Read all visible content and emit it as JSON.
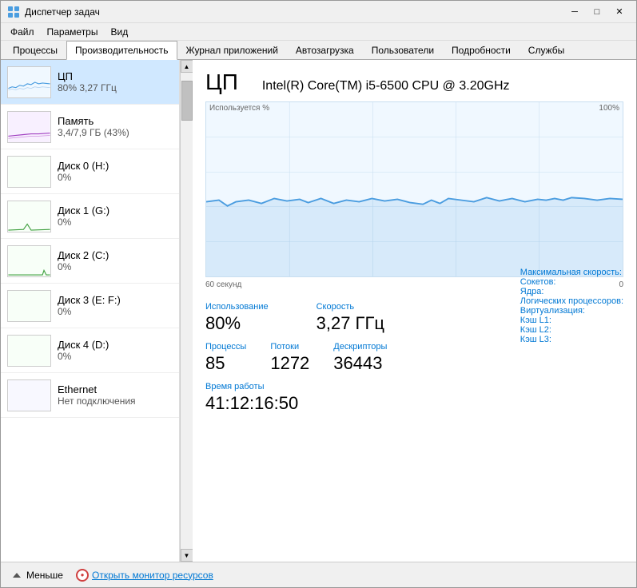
{
  "window": {
    "title": "Диспетчер задач",
    "icon": "⊞"
  },
  "title_buttons": {
    "minimize": "─",
    "maximize": "□",
    "close": "✕"
  },
  "menu": {
    "items": [
      "Файл",
      "Параметры",
      "Вид"
    ]
  },
  "tabs": [
    {
      "id": "processes",
      "label": "Процессы"
    },
    {
      "id": "performance",
      "label": "Производительность",
      "active": true
    },
    {
      "id": "app_history",
      "label": "Журнал приложений"
    },
    {
      "id": "startup",
      "label": "Автозагрузка"
    },
    {
      "id": "users",
      "label": "Пользователи"
    },
    {
      "id": "details",
      "label": "Подробности"
    },
    {
      "id": "services",
      "label": "Службы"
    }
  ],
  "sidebar": {
    "items": [
      {
        "id": "cpu",
        "name": "ЦП",
        "stat": "80% 3,27 ГГц",
        "active": true
      },
      {
        "id": "memory",
        "name": "Память",
        "stat": "3,4/7,9 ГБ (43%)"
      },
      {
        "id": "disk0",
        "name": "Диск 0 (H:)",
        "stat": "0%"
      },
      {
        "id": "disk1",
        "name": "Диск 1 (G:)",
        "stat": "0%"
      },
      {
        "id": "disk2",
        "name": "Диск 2 (C:)",
        "stat": "0%"
      },
      {
        "id": "disk3",
        "name": "Диск 3 (E: F:)",
        "stat": "0%"
      },
      {
        "id": "disk4",
        "name": "Диск 4 (D:)",
        "stat": "0%"
      },
      {
        "id": "ethernet",
        "name": "Ethernet",
        "stat": "Нет подключения"
      }
    ]
  },
  "main": {
    "cpu_title": "ЦП",
    "cpu_name": "Intel(R) Core(TM) i5-6500 CPU @ 3.20GHz",
    "graph_label": "Используется %",
    "graph_max": "100%",
    "graph_time": "60 секунд",
    "graph_zero": "0",
    "usage_label": "Использование",
    "usage_value": "80%",
    "speed_label": "Скорость",
    "speed_value": "3,27 ГГц",
    "processes_label": "Процессы",
    "processes_value": "85",
    "threads_label": "Потоки",
    "threads_value": "1272",
    "descriptors_label": "Дескрипторы",
    "descriptors_value": "36443",
    "uptime_label": "Время работы",
    "uptime_value": "41:12:16:50",
    "right_labels": [
      "Максимальная скорость:",
      "Сокетов:",
      "Ядра:",
      "Логических процессоров:",
      "Виртуализация:",
      "Кэш L1:",
      "Кэш L2:",
      "Кэш L3:"
    ]
  },
  "bottom_bar": {
    "less_label": "Меньше",
    "monitor_label": "Открыть монитор ресурсов"
  }
}
